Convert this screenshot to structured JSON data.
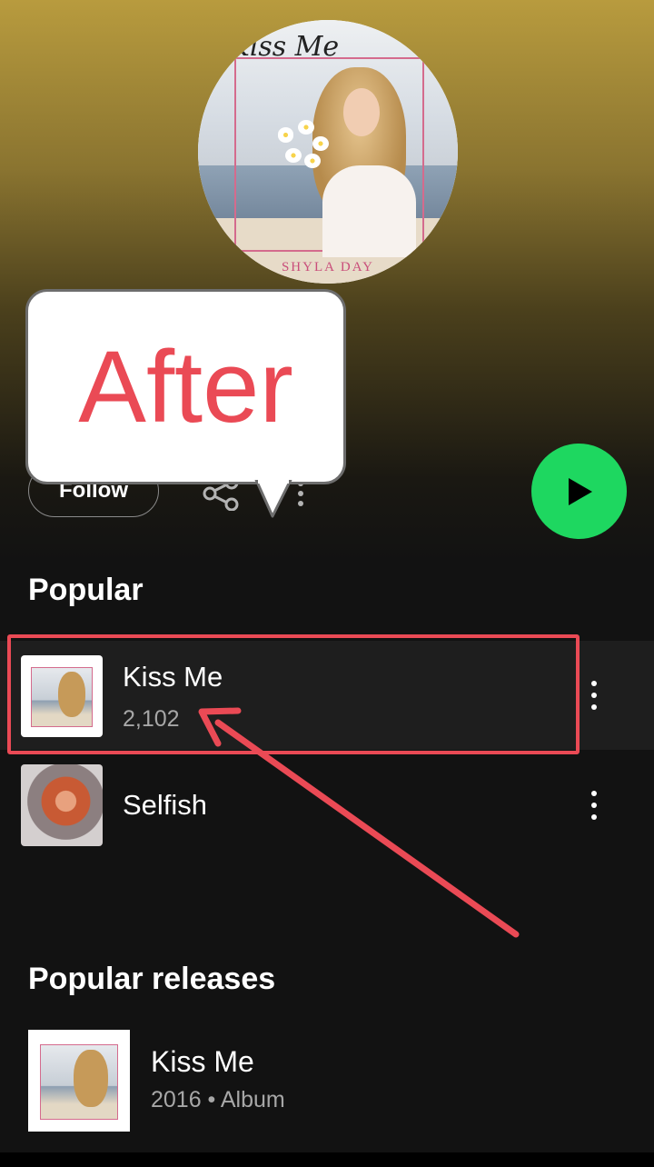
{
  "artist": {
    "image_icon": "artist-portrait",
    "cover_script_title": "Kiss Me",
    "cover_name": "SHYLA DAY"
  },
  "actions": {
    "follow_label": "Follow",
    "share_icon": "share-icon",
    "more_icon": "more-vertical-icon",
    "play_icon": "play-icon",
    "play_color": "#1ed760"
  },
  "callout": {
    "text": "After",
    "text_color": "#ea4a55"
  },
  "popular": {
    "title": "Popular",
    "tracks": [
      {
        "title": "Kiss Me",
        "plays": "2,102"
      },
      {
        "title": "Selfish",
        "plays": ""
      }
    ]
  },
  "releases": {
    "title": "Popular releases",
    "items": [
      {
        "title": "Kiss Me",
        "meta": "2016 • Album"
      }
    ]
  },
  "annotation": {
    "highlight_color": "#ea4a55"
  }
}
